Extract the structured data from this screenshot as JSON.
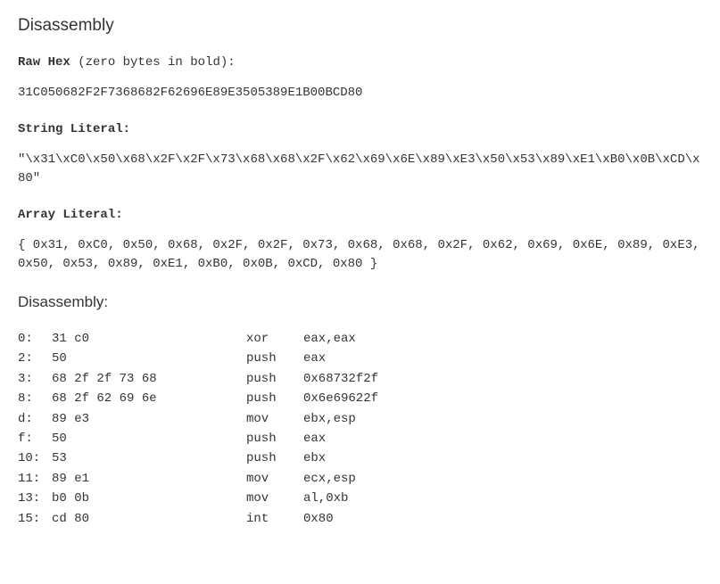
{
  "title": "Disassembly",
  "sections": {
    "rawhex": {
      "label": "Raw Hex",
      "note": " (zero bytes in bold):",
      "value": "31C050682F2F7368682F62696E89E3505389E1B00BCD80"
    },
    "stringlit": {
      "label": "String Literal:",
      "value": "\"\\x31\\xC0\\x50\\x68\\x2F\\x2F\\x73\\x68\\x68\\x2F\\x62\\x69\\x6E\\x89\\xE3\\x50\\x53\\x89\\xE1\\xB0\\x0B\\xCD\\x80\""
    },
    "arraylit": {
      "label": "Array Literal:",
      "value": "{ 0x31, 0xC0, 0x50, 0x68, 0x2F, 0x2F, 0x73, 0x68, 0x68, 0x2F, 0x62, 0x69, 0x6E, 0x89, 0xE3, 0x50, 0x53, 0x89, 0xE1, 0xB0, 0x0B, 0xCD, 0x80 }"
    },
    "disasm": {
      "heading": "Disassembly:",
      "rows": [
        {
          "offset": "0:",
          "bytes": "31 c0",
          "mnemonic": "xor",
          "operands": "eax,eax"
        },
        {
          "offset": "2:",
          "bytes": "50",
          "mnemonic": "push",
          "operands": "eax"
        },
        {
          "offset": "3:",
          "bytes": "68 2f 2f 73 68",
          "mnemonic": "push",
          "operands": "0x68732f2f"
        },
        {
          "offset": "8:",
          "bytes": "68 2f 62 69 6e",
          "mnemonic": "push",
          "operands": "0x6e69622f"
        },
        {
          "offset": "d:",
          "bytes": "89 e3",
          "mnemonic": "mov",
          "operands": "ebx,esp"
        },
        {
          "offset": "f:",
          "bytes": "50",
          "mnemonic": "push",
          "operands": "eax"
        },
        {
          "offset": "10:",
          "bytes": "53",
          "mnemonic": "push",
          "operands": "ebx"
        },
        {
          "offset": "11:",
          "bytes": "89 e1",
          "mnemonic": "mov",
          "operands": "ecx,esp"
        },
        {
          "offset": "13:",
          "bytes": "b0 0b",
          "mnemonic": "mov",
          "operands": "al,0xb"
        },
        {
          "offset": "15:",
          "bytes": "cd 80",
          "mnemonic": "int",
          "operands": "0x80"
        }
      ]
    }
  }
}
